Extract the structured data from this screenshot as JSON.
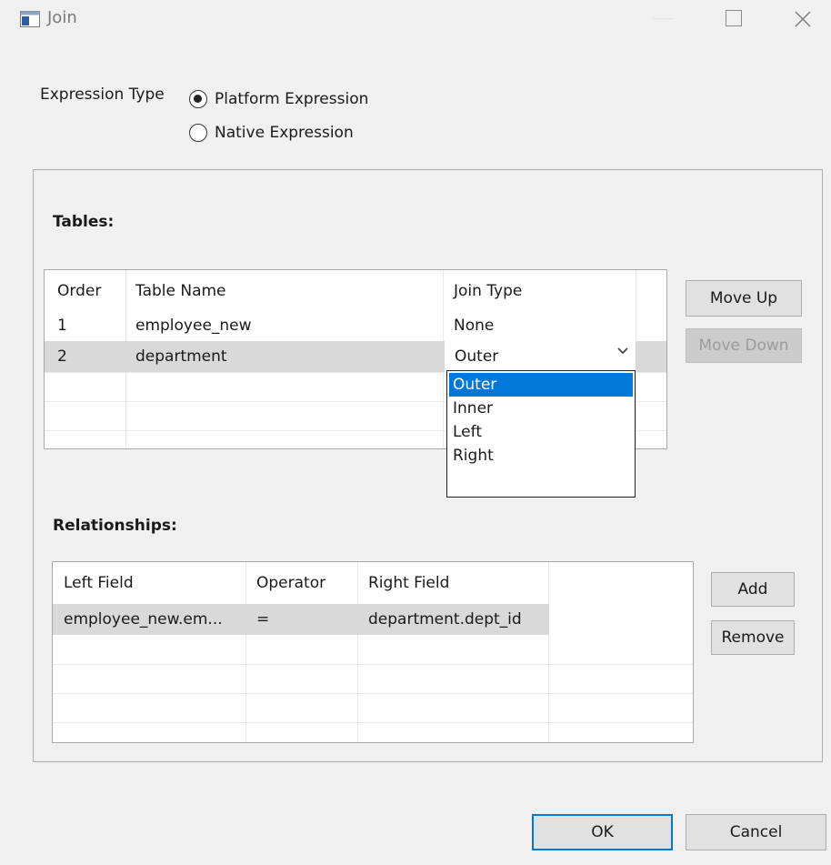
{
  "window": {
    "title": "Join"
  },
  "expression_type": {
    "label": "Expression Type",
    "options": [
      {
        "label": "Platform Expression",
        "checked": true
      },
      {
        "label": "Native Expression",
        "checked": false
      }
    ]
  },
  "tables": {
    "label": "Tables:",
    "columns": [
      "Order",
      "Table Name",
      "Join Type"
    ],
    "rows": [
      {
        "order": "1",
        "name": "employee_new",
        "join": "None"
      },
      {
        "order": "2",
        "name": "department",
        "join": "Outer"
      }
    ],
    "dropdown_options": [
      "Outer",
      "Inner",
      "Left",
      "Right"
    ],
    "dropdown_selected": "Outer"
  },
  "relationships": {
    "label": "Relationships:",
    "columns": [
      "Left Field",
      "Operator",
      "Right Field"
    ],
    "rows": [
      {
        "left": "employee_new.em...",
        "op": "=",
        "right": "department.dept_id"
      }
    ]
  },
  "buttons": {
    "move_up": "Move Up",
    "move_down": "Move Down",
    "add": "Add",
    "remove": "Remove",
    "ok": "OK",
    "cancel": "Cancel"
  },
  "colors": {
    "accent": "#0078d7",
    "selected_row": "#d9d9d9"
  }
}
